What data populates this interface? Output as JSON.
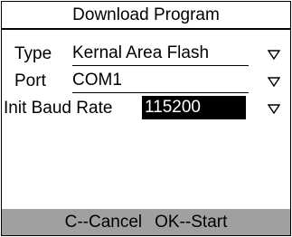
{
  "title": "Download Program",
  "fields": [
    {
      "label": "Type",
      "value": "Kernal Area Flash",
      "selected": false,
      "icon": "dropdown-triangle-icon"
    },
    {
      "label": "Port",
      "value": "COM1",
      "selected": false,
      "icon": "dropdown-triangle-icon"
    },
    {
      "label": "Init Baud Rate",
      "value": "115200",
      "selected": true,
      "icon": "dropdown-triangle-icon"
    }
  ],
  "footer": {
    "cancel": "C--Cancel",
    "start": "OK--Start"
  },
  "colors": {
    "footer_bg": "#a0a0a0",
    "highlight_bg": "#000000",
    "highlight_fg": "#ffffff"
  }
}
